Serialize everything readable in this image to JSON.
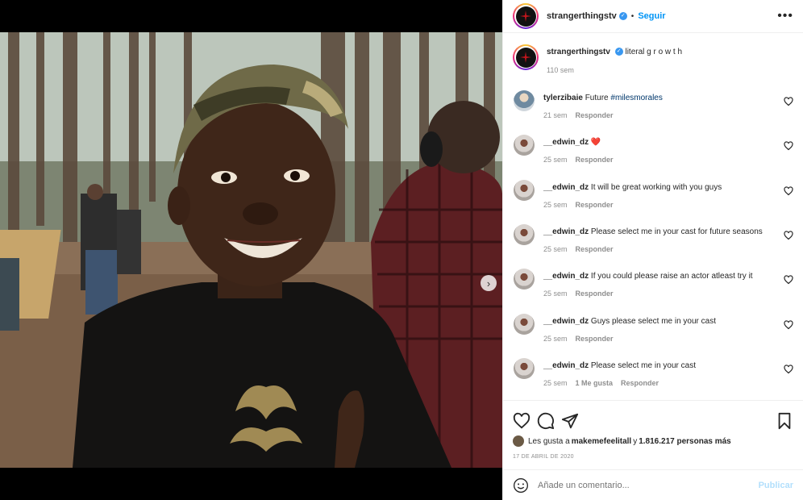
{
  "post": {
    "author": "strangerthingstv",
    "follow_label": "Seguir",
    "separator": "•",
    "more_label": "•••",
    "caption_text": "literal g r o w t h",
    "caption_time": "110 sem",
    "reply_label": "Responder"
  },
  "comments": [
    {
      "user": "tylerzibaie",
      "text": "Future ",
      "hashtag": "#milesmorales",
      "time": "21 sem",
      "likes": "",
      "reply": "Responder"
    },
    {
      "user": "__edwin_dz",
      "text": "❤️",
      "hashtag": "",
      "time": "25 sem",
      "likes": "",
      "reply": "Responder"
    },
    {
      "user": "__edwin_dz",
      "text": "It will be great working with you guys",
      "hashtag": "",
      "time": "25 sem",
      "likes": "",
      "reply": "Responder"
    },
    {
      "user": "__edwin_dz",
      "text": "Please select me in your cast for future seasons",
      "hashtag": "",
      "time": "25 sem",
      "likes": "",
      "reply": "Responder"
    },
    {
      "user": "__edwin_dz",
      "text": "If you could please raise an actor atleast try it",
      "hashtag": "",
      "time": "25 sem",
      "likes": "",
      "reply": "Responder"
    },
    {
      "user": "__edwin_dz",
      "text": "Guys please select me in your cast",
      "hashtag": "",
      "time": "25 sem",
      "likes": "",
      "reply": "Responder"
    },
    {
      "user": "__edwin_dz",
      "text": "Please select me in your cast",
      "hashtag": "",
      "time": "25 sem",
      "likes": "1 Me gusta",
      "reply": "Responder"
    }
  ],
  "likes": {
    "prefix": "Les gusta a ",
    "user": "makemefeelitall",
    "middle": " y ",
    "count": "1.816.217 personas más"
  },
  "date": "17 DE ABRIL DE 2020",
  "composer": {
    "placeholder": "Añade un comentario...",
    "publish_label": "Publicar"
  },
  "carousel": {
    "slides": 3,
    "active": 1
  },
  "icons": {
    "like": "heart-icon",
    "comment": "comment-icon",
    "share": "share-icon",
    "save": "bookmark-icon",
    "emoji": "emoji-icon",
    "next": "chevron-right-icon",
    "tag": "user-tag-icon"
  },
  "colors": {
    "accent": "#0095f6",
    "verified": "#3897f0",
    "publish_disabled": "#b2dffc"
  }
}
